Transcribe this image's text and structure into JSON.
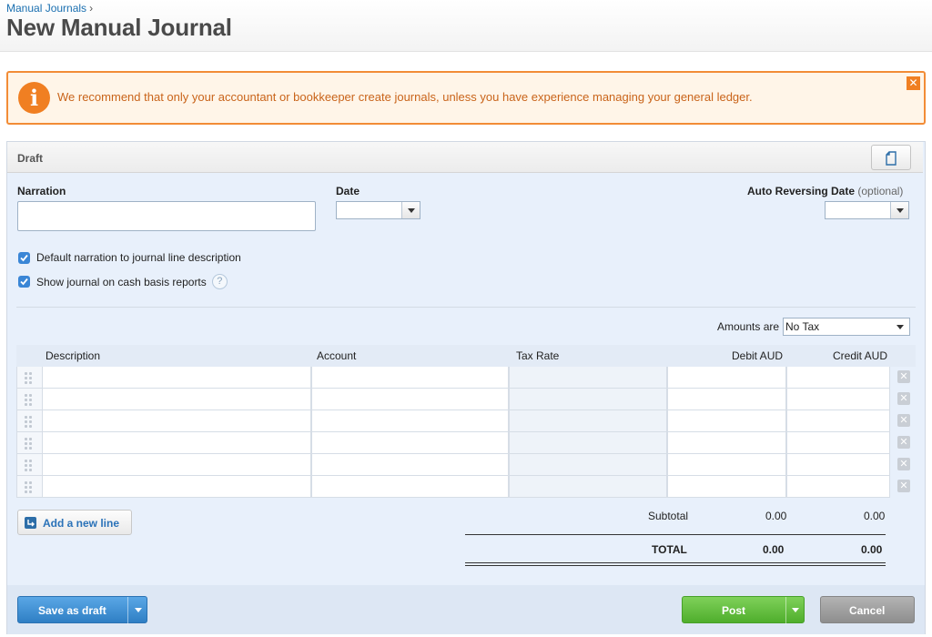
{
  "breadcrumb": {
    "parent": "Manual Journals",
    "separator": "›"
  },
  "page": {
    "title": "New Manual Journal"
  },
  "warning": {
    "icon": "info-icon",
    "text": "We recommend that only your accountant or bookkeeper create journals, unless you have experience managing your general ledger.",
    "close": "✕"
  },
  "status": {
    "label": "Draft"
  },
  "form": {
    "narration_label": "Narration",
    "narration_value": "",
    "date_label": "Date",
    "date_value": "",
    "auto_reversing_label": "Auto Reversing Date",
    "auto_reversing_optional": "(optional)",
    "auto_reversing_value": "",
    "default_narration_label": "Default narration to journal line description",
    "default_narration_checked": true,
    "cash_basis_label": "Show journal on cash basis reports",
    "cash_basis_checked": true,
    "help": "?",
    "amounts_are_label": "Amounts are",
    "amounts_are_value": "No Tax"
  },
  "table": {
    "columns": [
      "Description",
      "Account",
      "Tax Rate",
      "Debit AUD",
      "Credit AUD"
    ],
    "rows": [
      {
        "description": "",
        "account": "",
        "tax_rate": "",
        "debit": "",
        "credit": ""
      },
      {
        "description": "",
        "account": "",
        "tax_rate": "",
        "debit": "",
        "credit": ""
      },
      {
        "description": "",
        "account": "",
        "tax_rate": "",
        "debit": "",
        "credit": ""
      },
      {
        "description": "",
        "account": "",
        "tax_rate": "",
        "debit": "",
        "credit": ""
      },
      {
        "description": "",
        "account": "",
        "tax_rate": "",
        "debit": "",
        "credit": ""
      },
      {
        "description": "",
        "account": "",
        "tax_rate": "",
        "debit": "",
        "credit": ""
      }
    ],
    "delete_glyph": "✕"
  },
  "add_line": {
    "label": "Add a new line"
  },
  "totals": {
    "subtotal_label": "Subtotal",
    "subtotal_debit": "0.00",
    "subtotal_credit": "0.00",
    "total_label": "TOTAL",
    "total_debit": "0.00",
    "total_credit": "0.00"
  },
  "footer": {
    "save_draft": "Save as draft",
    "post": "Post",
    "cancel": "Cancel"
  },
  "colors": {
    "warning_border": "#f28c36",
    "warning_text": "#c9641a",
    "panel_bg": "#e8f0fb",
    "save_button": "#3a8bd0",
    "post_button": "#5dbd38",
    "cancel_button": "#9e9e9e"
  }
}
